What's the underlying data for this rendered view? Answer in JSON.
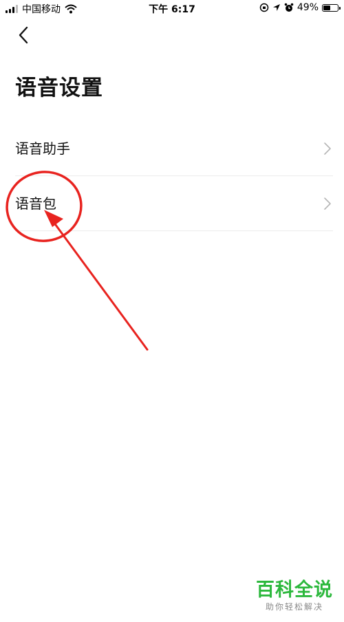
{
  "status_bar": {
    "carrier": "中国移动",
    "time": "下午 6:17",
    "battery_percent": "49%",
    "battery_level": 0.49,
    "icons": [
      "signal-icon",
      "wifi-icon",
      "orientation-lock-icon",
      "location-icon",
      "alarm-icon",
      "battery-icon"
    ]
  },
  "nav": {
    "back_icon": "chevron-left-icon"
  },
  "page": {
    "title": "语音设置"
  },
  "items": [
    {
      "label": "语音助手",
      "icon": "chevron-right-icon"
    },
    {
      "label": "语音包",
      "icon": "chevron-right-icon"
    }
  ],
  "annotation": {
    "color": "#e8231f",
    "shapes": [
      "circle",
      "arrow"
    ]
  },
  "watermark": {
    "main": "百科全说",
    "sub": "助你轻松解决",
    "color": "#2db83d"
  }
}
